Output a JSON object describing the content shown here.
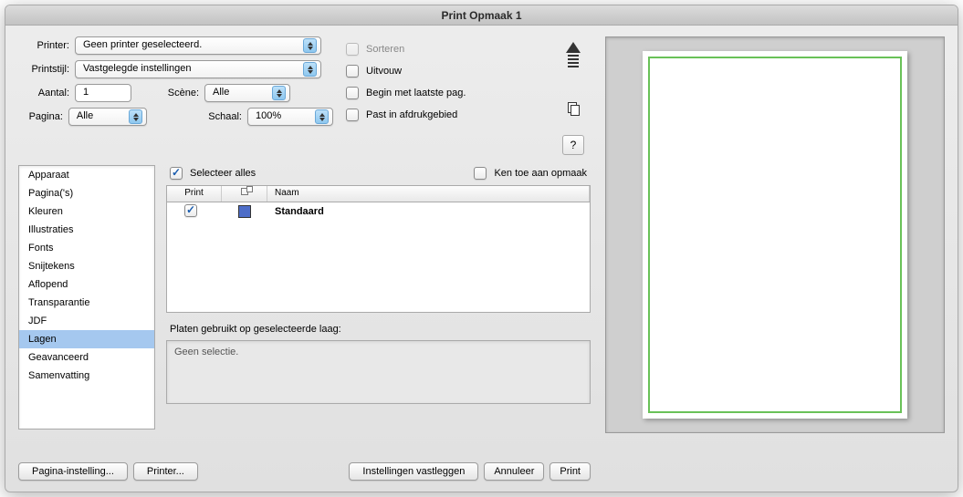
{
  "title": "Print Opmaak 1",
  "labels": {
    "printer": "Printer:",
    "printstijl": "Printstijl:",
    "aantal": "Aantal:",
    "pagina": "Pagina:",
    "scene": "Scène:",
    "schaal": "Schaal:"
  },
  "values": {
    "printer": "Geen printer geselecteerd.",
    "printstijl": "Vastgelegde instellingen",
    "aantal": "1",
    "pagina": "Alle",
    "scene": "Alle",
    "schaal": "100%"
  },
  "checkboxes": {
    "sorteren": "Sorteren",
    "uitvouw": "Uitvouw",
    "begin_laatste": "Begin met laatste pag.",
    "past_in": "Past in afdrukgebied"
  },
  "help": "?",
  "sidebar": [
    "Apparaat",
    "Pagina('s)",
    "Kleuren",
    "Illustraties",
    "Fonts",
    "Snijtekens",
    "Aflopend",
    "Transparantie",
    "JDF",
    "Lagen",
    "Geavanceerd",
    "Samenvatting"
  ],
  "sidebar_selected": 9,
  "panel": {
    "select_all": "Selecteer alles",
    "assign_layout": "Ken toe aan opmaak",
    "col_print": "Print",
    "col_name": "Naam",
    "row_name": "Standaard",
    "plates_label": "Platen gebruikt op geselecteerde laag:",
    "no_selection": "Geen selectie."
  },
  "buttons": {
    "page_setup": "Pagina-instelling...",
    "printer_btn": "Printer...",
    "capture": "Instellingen vastleggen",
    "cancel": "Annuleer",
    "print": "Print"
  }
}
